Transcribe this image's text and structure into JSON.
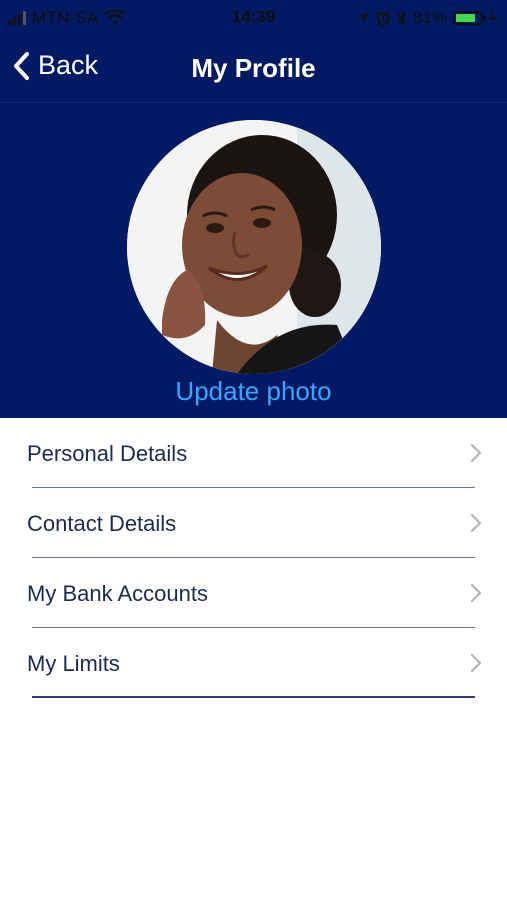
{
  "status_bar": {
    "carrier": "MTN-SA",
    "time": "14:39",
    "battery_percent": "81%",
    "battery_level": 0.81,
    "icons": [
      "signal-icon",
      "wifi-icon",
      "location-icon",
      "alarm-icon",
      "bluetooth-icon",
      "battery-icon",
      "charging-icon"
    ]
  },
  "nav": {
    "back_label": "Back",
    "title": "My Profile"
  },
  "profile": {
    "update_photo_label": "Update photo"
  },
  "menu": {
    "items": [
      {
        "label": "Personal Details"
      },
      {
        "label": "Contact Details"
      },
      {
        "label": "My Bank Accounts"
      },
      {
        "label": "My Limits"
      }
    ]
  },
  "colors": {
    "header_bg": "#021a63",
    "link_blue": "#3aa4ff",
    "menu_text": "#1b2a55",
    "divider": "#6b74a7"
  }
}
